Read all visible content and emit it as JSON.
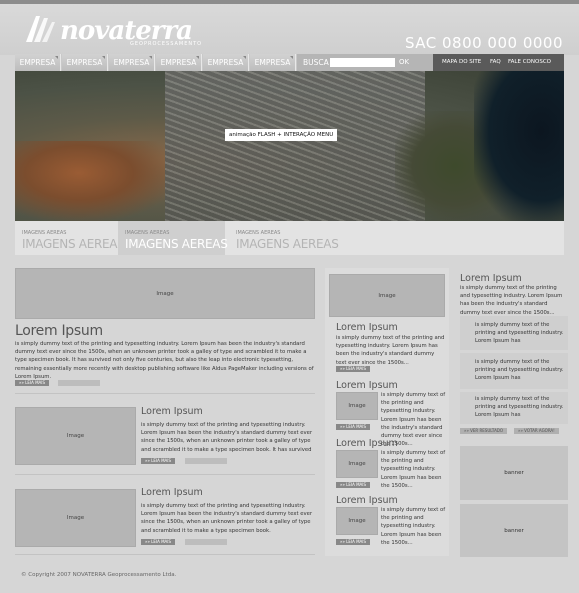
{
  "header": {
    "logo_text": "novaterra",
    "logo_sub": "GEOPROCESSAMENTO",
    "sac": "SAC 0800 000 0000"
  },
  "nav": {
    "tabs": [
      "EMPRESA",
      "EMPRESA",
      "EMPRESA",
      "EMPRESA",
      "EMPRESA",
      "EMPRESA"
    ],
    "search_label": "BUSCA",
    "search_value": "",
    "search_ok": "OK",
    "right_links": [
      "MAPA DO SITE",
      "FAQ",
      "FALE CONOSCO"
    ]
  },
  "hero": {
    "label": "animação FLASH + INTERAÇÃO MENU"
  },
  "subnav": [
    {
      "small": "IMAGENS AEREAS",
      "big": "IMAGENS AEREAS",
      "active": false
    },
    {
      "small": "IMAGENS AEREAS",
      "big": "IMAGENS AEREAS",
      "active": true
    },
    {
      "small": "IMAGENS AEREAS",
      "big": "IMAGENS AEREAS",
      "active": false
    }
  ],
  "left": {
    "image_label": "Image",
    "title": "Lorem Ipsum",
    "text": "is simply dummy text of the printing and typesetting industry. Lorem Ipsum has been the industry's standard dummy text ever since the 1500s, when an unknown printer took a galley of type and scrambled it to make a type specimen book. It has survived not only five centuries, but also the leap into electronic typesetting, remaining essentially more recently with desktop publishing software like Aldus PageMaker including versions of Lorem Ipsum.",
    "read_more": "»» LEIA MAIS",
    "items": [
      {
        "image_label": "Image",
        "title": "Lorem Ipsum",
        "text": "is simply dummy text of the printing and typesetting industry. Lorem Ipsum has been the industry's standard dummy text ever since the 1500s, when an unknown printer took a galley of type and scrambled it to make a type specimen book. It has survived",
        "read_more": "»» LEIA MAIS"
      },
      {
        "image_label": "Image",
        "title": "Lorem Ipsum",
        "text": "is simply dummy text of the printing and typesetting industry. Lorem Ipsum has been the industry's standard dummy text ever since the 1500s, when an unknown printer took a galley of type and scrambled it to make a type specimen book.",
        "read_more": "»» LEIA MAIS"
      }
    ]
  },
  "middle": {
    "image_label": "Image",
    "title": "Lorem Ipsum",
    "text": "is simply dummy text of the printing and typesetting industry. Lorem Ipsum has been the industry's standard dummy text ever since the 1500s...",
    "read_more": "»» LEIA MAIS",
    "items": [
      {
        "title": "Lorem Ipsum",
        "image_label": "Image",
        "text": "is simply dummy text of the printing and typesetting industry. Lorem Ipsum has been the industry's standard dummy text ever since the 1500s...",
        "read_more": "»» LEIA MAIS"
      },
      {
        "title": "Lorem Ipsum",
        "image_label": "Image",
        "text": "is simply dummy text of the printing and typesetting industry. Lorem Ipsum has been the 1500s...",
        "read_more": "»» LEIA MAIS"
      },
      {
        "title": "Lorem Ipsum",
        "image_label": "Image",
        "text": "is simply dummy text of the printing and typesetting industry. Lorem Ipsum has been the 1500s...",
        "read_more": "»» LEIA MAIS"
      }
    ]
  },
  "right": {
    "title": "Lorem Ipsum",
    "text": "is simply dummy text of the printing and typesetting industry. Lorem Ipsum has been the industry's standard dummy text ever since the 1500s...",
    "items": [
      "is simply dummy text of the printing and typesetting industry. Lorem Ipsum has",
      "is simply dummy text of the printing and typesetting industry. Lorem Ipsum has",
      "is simply dummy text of the printing and typesetting industry. Lorem Ipsum has"
    ],
    "btn_results": "»» VER RESULTADO",
    "btn_vote": "»» VOTAR AGORA!",
    "banners": [
      "banner",
      "banner"
    ]
  },
  "footer": "© Copyright 2007 NOVATERRA Geoprocessamento Ltda."
}
